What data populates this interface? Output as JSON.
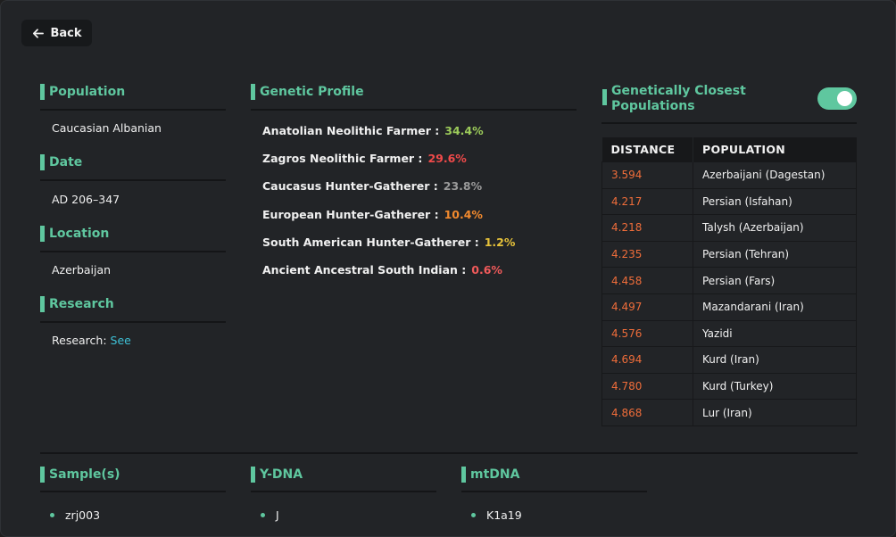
{
  "back_label": "Back",
  "population": {
    "title": "Population",
    "value": "Caucasian Albanian"
  },
  "date": {
    "title": "Date",
    "value": "AD 206–347"
  },
  "location": {
    "title": "Location",
    "value": "Azerbaijan"
  },
  "research": {
    "title": "Research",
    "prefix": "Research:",
    "link": "See"
  },
  "genetic_profile": {
    "title": "Genetic Profile",
    "items": [
      {
        "label": "Anatolian Neolithic Farmer :",
        "pct": "34.4%",
        "color": "#9ccb5a"
      },
      {
        "label": "Zagros Neolithic Farmer :",
        "pct": "29.6%",
        "color": "#f04a4a"
      },
      {
        "label": "Caucasus Hunter-Gatherer :",
        "pct": "23.8%",
        "color": "#9a9a9a"
      },
      {
        "label": "European Hunter-Gatherer :",
        "pct": "10.4%",
        "color": "#f28a2e"
      },
      {
        "label": "South American Hunter-Gatherer :",
        "pct": "1.2%",
        "color": "#e6c23a"
      },
      {
        "label": "Ancient Ancestral South Indian :",
        "pct": "0.6%",
        "color": "#f05a5a"
      }
    ]
  },
  "closest": {
    "title": "Genetically Closest Populations",
    "toggle_on": true,
    "headers": {
      "distance": "DISTANCE",
      "population": "POPULATION"
    },
    "rows": [
      {
        "distance": "3.594",
        "population": "Azerbaijani (Dagestan)"
      },
      {
        "distance": "4.217",
        "population": "Persian (Isfahan)"
      },
      {
        "distance": "4.218",
        "population": "Talysh (Azerbaijan)"
      },
      {
        "distance": "4.235",
        "population": "Persian (Tehran)"
      },
      {
        "distance": "4.458",
        "population": "Persian (Fars)"
      },
      {
        "distance": "4.497",
        "population": "Mazandarani (Iran)"
      },
      {
        "distance": "4.576",
        "population": "Yazidi"
      },
      {
        "distance": "4.694",
        "population": "Kurd (Iran)"
      },
      {
        "distance": "4.780",
        "population": "Kurd (Turkey)"
      },
      {
        "distance": "4.868",
        "population": "Lur (Iran)"
      }
    ]
  },
  "samples": {
    "title": "Sample(s)",
    "items": [
      "zrj003"
    ]
  },
  "ydna": {
    "title": "Y-DNA",
    "items": [
      "J"
    ]
  },
  "mtdna": {
    "title": "mtDNA",
    "items": [
      "K1a19"
    ]
  },
  "colors": {
    "accent": "#5fc79f",
    "distance": "#ef6d3a",
    "link": "#3ec0d6"
  }
}
